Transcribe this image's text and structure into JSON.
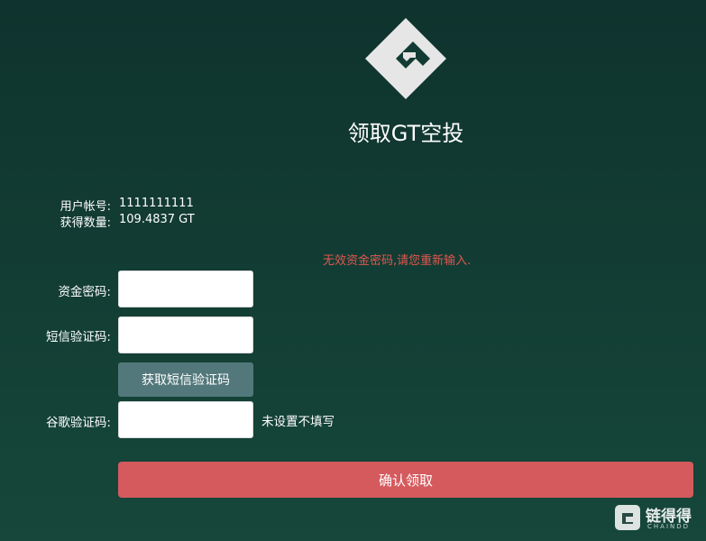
{
  "header": {
    "logo_icon": "gt-diamond-logo-icon",
    "title": "领取GT空投"
  },
  "account": {
    "user_label": "用户帐号:",
    "user_value": "1111111111",
    "amount_label": "获得数量:",
    "amount_value": "109.4837 GT"
  },
  "error_message": "无效资金密码,请您重新输入.",
  "form": {
    "fund_password_label": "资金密码:",
    "fund_password_value": "",
    "sms_code_label": "短信验证码:",
    "sms_code_value": "",
    "get_sms_button": "获取短信验证码",
    "google_code_label": "谷歌验证码:",
    "google_code_value": "",
    "google_hint": "未设置不填写",
    "confirm_button": "确认领取"
  },
  "watermark": {
    "icon": "chainod-logo-icon",
    "text": "链得得",
    "subtext": "CHAINDD"
  },
  "colors": {
    "background_top": "#0f332e",
    "background_bottom": "#16473a",
    "error": "#e2564f",
    "sms_button": "#53787b",
    "confirm_button": "#d55a5e"
  }
}
